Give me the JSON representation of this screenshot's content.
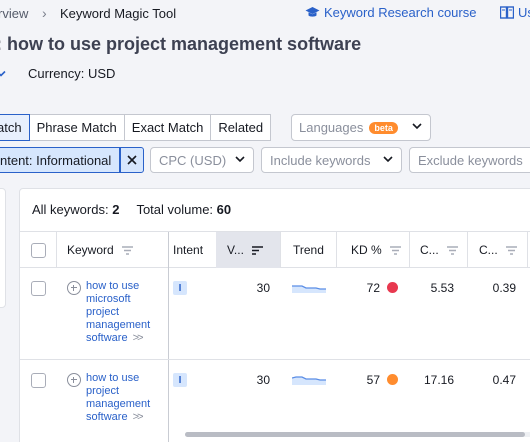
{
  "breadcrumb": {
    "prev": "rview",
    "separator": "›",
    "current": "Keyword Magic Tool"
  },
  "header_links": {
    "course": "Keyword Research course",
    "user_manual": "Us"
  },
  "title": {
    "prefix": ":",
    "query": "how to use project management software"
  },
  "currency": "Currency: USD",
  "match_tabs": [
    {
      "label": "atch",
      "active": true
    },
    {
      "label": "Phrase Match",
      "active": false
    },
    {
      "label": "Exact Match",
      "active": false
    },
    {
      "label": "Related",
      "active": false
    }
  ],
  "languages": {
    "placeholder": "Languages",
    "badge": "beta"
  },
  "filters": {
    "intent_chip": "ntent: Informational",
    "cpc": "CPC (USD)",
    "include": "Include keywords",
    "exclude": "Exclude keywords"
  },
  "summary": {
    "all_keywords_label": "All keywords:",
    "all_keywords_value": "2",
    "total_volume_label": "Total volume:",
    "total_volume_value": "60"
  },
  "columns": {
    "keyword": "Keyword",
    "intent": "Intent",
    "volume": "V...",
    "trend": "Trend",
    "kd": "KD %",
    "cpc": "C...",
    "com": "C..."
  },
  "rows": [
    {
      "keyword": "how to use microsoft project management software",
      "intent": "I",
      "volume": "30",
      "kd": "72",
      "kd_color": "#e8384f",
      "cpc": "5.53",
      "com": "0.39"
    },
    {
      "keyword": "how to use project management software",
      "intent": "I",
      "volume": "30",
      "kd": "57",
      "kd_color": "#ff8c2e",
      "cpc": "17.16",
      "com": "0.47"
    }
  ],
  "colors": {
    "accent": "#2a61c9",
    "chip_bg": "#d6e6fd",
    "beta": "#ff8c2e"
  }
}
